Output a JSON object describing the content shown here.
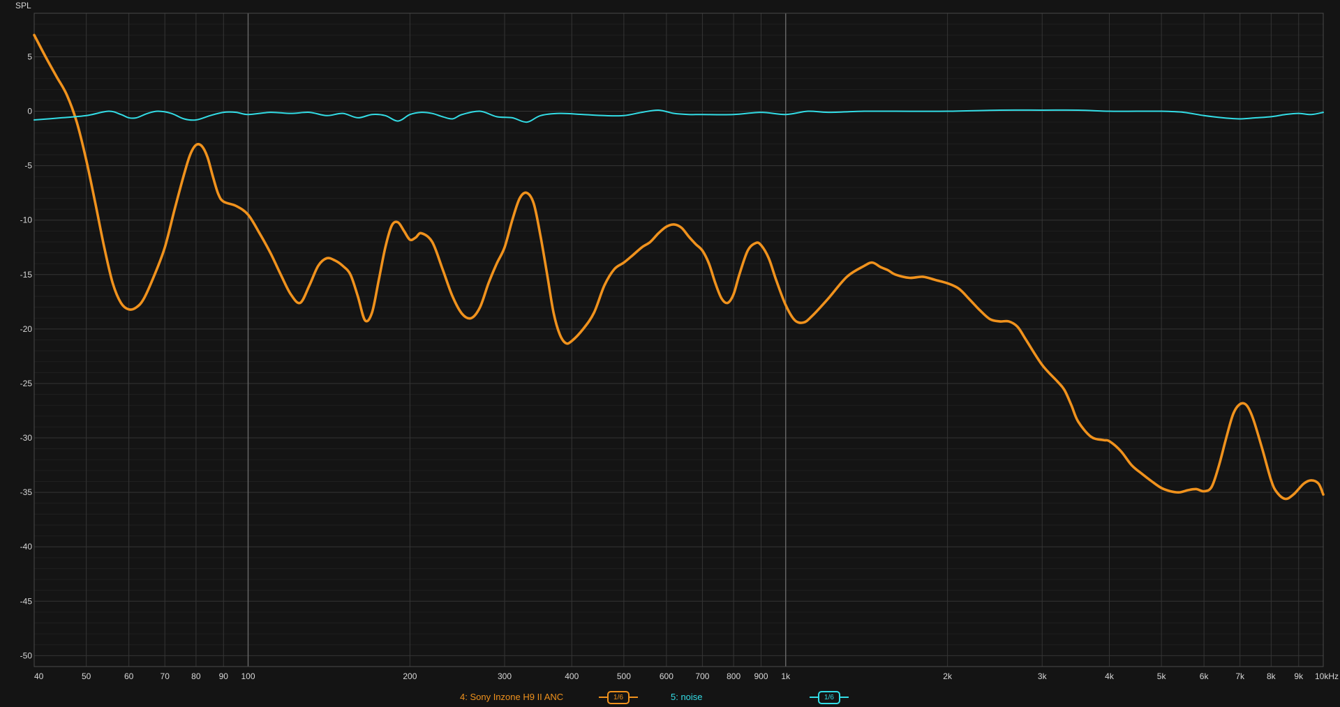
{
  "chart_data": {
    "type": "line",
    "ylabel": "SPL",
    "x_scale": "log",
    "xlim": [
      40,
      10000
    ],
    "ylim": [
      -51,
      9
    ],
    "grid": true,
    "y_ticks": [
      5,
      0,
      -5,
      -10,
      -15,
      -20,
      -25,
      -30,
      -35,
      -40,
      -45,
      -50
    ],
    "y_tick_labels": [
      "5",
      "0",
      "-5",
      "-10",
      "-15",
      "-20",
      "-25",
      "-30",
      "-35",
      "-40",
      "-45",
      "-50"
    ],
    "x_ticks": [
      40,
      50,
      60,
      70,
      80,
      90,
      100,
      200,
      300,
      400,
      500,
      600,
      700,
      800,
      900,
      1000,
      2000,
      3000,
      4000,
      5000,
      6000,
      7000,
      8000,
      9000,
      10000
    ],
    "x_tick_labels": [
      "40",
      "50",
      "60",
      "70",
      "80",
      "90",
      "100",
      "200",
      "300",
      "400",
      "500",
      "600",
      "700",
      "800",
      "900",
      "1k",
      "2k",
      "3k",
      "4k",
      "5k",
      "6k",
      "7k",
      "8k",
      "9k",
      "10kHz"
    ],
    "series": [
      {
        "name": "4: Sony Inzone H9 II ANC",
        "color": "#f0921d",
        "smoothing": "1/6",
        "points": [
          [
            40,
            7.0
          ],
          [
            42,
            5.0
          ],
          [
            44,
            3.2
          ],
          [
            46,
            1.5
          ],
          [
            48,
            -1.0
          ],
          [
            50,
            -4.5
          ],
          [
            52,
            -8.5
          ],
          [
            54,
            -12.5
          ],
          [
            56,
            -15.8
          ],
          [
            58,
            -17.6
          ],
          [
            60,
            -18.2
          ],
          [
            62,
            -18.0
          ],
          [
            64,
            -17.2
          ],
          [
            67,
            -15.0
          ],
          [
            70,
            -12.5
          ],
          [
            73,
            -9.0
          ],
          [
            76,
            -5.8
          ],
          [
            78,
            -4.0
          ],
          [
            80,
            -3.1
          ],
          [
            82,
            -3.2
          ],
          [
            84,
            -4.2
          ],
          [
            86,
            -6.0
          ],
          [
            88,
            -7.6
          ],
          [
            90,
            -8.3
          ],
          [
            95,
            -8.7
          ],
          [
            100,
            -9.5
          ],
          [
            105,
            -11.2
          ],
          [
            110,
            -13.0
          ],
          [
            115,
            -15.0
          ],
          [
            120,
            -16.8
          ],
          [
            125,
            -17.6
          ],
          [
            130,
            -16.0
          ],
          [
            135,
            -14.2
          ],
          [
            140,
            -13.5
          ],
          [
            145,
            -13.7
          ],
          [
            150,
            -14.2
          ],
          [
            155,
            -15.0
          ],
          [
            160,
            -17.0
          ],
          [
            165,
            -19.2
          ],
          [
            170,
            -18.5
          ],
          [
            175,
            -15.5
          ],
          [
            180,
            -12.5
          ],
          [
            185,
            -10.5
          ],
          [
            190,
            -10.2
          ],
          [
            195,
            -11.0
          ],
          [
            200,
            -11.8
          ],
          [
            205,
            -11.6
          ],
          [
            210,
            -11.2
          ],
          [
            220,
            -12.0
          ],
          [
            230,
            -14.5
          ],
          [
            240,
            -17.0
          ],
          [
            250,
            -18.6
          ],
          [
            260,
            -19.0
          ],
          [
            270,
            -18.0
          ],
          [
            280,
            -15.8
          ],
          [
            290,
            -14.0
          ],
          [
            300,
            -12.5
          ],
          [
            310,
            -10.0
          ],
          [
            320,
            -8.0
          ],
          [
            330,
            -7.5
          ],
          [
            340,
            -8.5
          ],
          [
            350,
            -11.5
          ],
          [
            360,
            -15.0
          ],
          [
            370,
            -18.5
          ],
          [
            380,
            -20.5
          ],
          [
            390,
            -21.3
          ],
          [
            400,
            -21.1
          ],
          [
            420,
            -20.0
          ],
          [
            440,
            -18.5
          ],
          [
            460,
            -16.0
          ],
          [
            480,
            -14.5
          ],
          [
            500,
            -13.9
          ],
          [
            520,
            -13.2
          ],
          [
            540,
            -12.5
          ],
          [
            560,
            -12.0
          ],
          [
            580,
            -11.2
          ],
          [
            600,
            -10.6
          ],
          [
            620,
            -10.4
          ],
          [
            640,
            -10.7
          ],
          [
            660,
            -11.5
          ],
          [
            680,
            -12.2
          ],
          [
            700,
            -12.8
          ],
          [
            720,
            -14.0
          ],
          [
            740,
            -15.8
          ],
          [
            760,
            -17.2
          ],
          [
            780,
            -17.6
          ],
          [
            800,
            -16.8
          ],
          [
            820,
            -15.0
          ],
          [
            850,
            -12.8
          ],
          [
            880,
            -12.1
          ],
          [
            900,
            -12.3
          ],
          [
            930,
            -13.5
          ],
          [
            960,
            -15.5
          ],
          [
            1000,
            -17.8
          ],
          [
            1040,
            -19.2
          ],
          [
            1080,
            -19.4
          ],
          [
            1120,
            -18.8
          ],
          [
            1200,
            -17.2
          ],
          [
            1300,
            -15.2
          ],
          [
            1400,
            -14.2
          ],
          [
            1450,
            -13.9
          ],
          [
            1500,
            -14.3
          ],
          [
            1550,
            -14.6
          ],
          [
            1600,
            -15.0
          ],
          [
            1700,
            -15.3
          ],
          [
            1800,
            -15.2
          ],
          [
            1900,
            -15.5
          ],
          [
            2000,
            -15.8
          ],
          [
            2100,
            -16.3
          ],
          [
            2200,
            -17.3
          ],
          [
            2300,
            -18.3
          ],
          [
            2400,
            -19.1
          ],
          [
            2500,
            -19.3
          ],
          [
            2600,
            -19.3
          ],
          [
            2700,
            -19.8
          ],
          [
            2800,
            -21.0
          ],
          [
            3000,
            -23.3
          ],
          [
            3200,
            -24.8
          ],
          [
            3300,
            -25.6
          ],
          [
            3400,
            -27.0
          ],
          [
            3500,
            -28.5
          ],
          [
            3700,
            -29.9
          ],
          [
            3900,
            -30.2
          ],
          [
            4000,
            -30.3
          ],
          [
            4200,
            -31.2
          ],
          [
            4400,
            -32.5
          ],
          [
            4600,
            -33.3
          ],
          [
            4800,
            -34.0
          ],
          [
            5000,
            -34.6
          ],
          [
            5200,
            -34.9
          ],
          [
            5400,
            -35.0
          ],
          [
            5600,
            -34.8
          ],
          [
            5800,
            -34.7
          ],
          [
            6000,
            -34.9
          ],
          [
            6200,
            -34.5
          ],
          [
            6400,
            -32.5
          ],
          [
            6600,
            -30.0
          ],
          [
            6800,
            -27.8
          ],
          [
            7000,
            -26.9
          ],
          [
            7200,
            -27.0
          ],
          [
            7400,
            -28.2
          ],
          [
            7700,
            -31.0
          ],
          [
            8000,
            -33.9
          ],
          [
            8200,
            -35.0
          ],
          [
            8500,
            -35.6
          ],
          [
            8800,
            -35.2
          ],
          [
            9200,
            -34.2
          ],
          [
            9500,
            -33.9
          ],
          [
            9800,
            -34.2
          ],
          [
            10000,
            -35.2
          ]
        ]
      },
      {
        "name": "5: noise",
        "color": "#33dde6",
        "smoothing": "1/6",
        "points": [
          [
            40,
            -0.8
          ],
          [
            45,
            -0.6
          ],
          [
            50,
            -0.4
          ],
          [
            55,
            0.0
          ],
          [
            58,
            -0.3
          ],
          [
            60,
            -0.6
          ],
          [
            62,
            -0.6
          ],
          [
            65,
            -0.2
          ],
          [
            68,
            0.0
          ],
          [
            72,
            -0.2
          ],
          [
            76,
            -0.7
          ],
          [
            80,
            -0.8
          ],
          [
            85,
            -0.4
          ],
          [
            90,
            -0.1
          ],
          [
            95,
            -0.1
          ],
          [
            100,
            -0.3
          ],
          [
            110,
            -0.1
          ],
          [
            120,
            -0.2
          ],
          [
            130,
            -0.1
          ],
          [
            140,
            -0.4
          ],
          [
            150,
            -0.2
          ],
          [
            160,
            -0.6
          ],
          [
            170,
            -0.3
          ],
          [
            180,
            -0.4
          ],
          [
            190,
            -0.9
          ],
          [
            200,
            -0.3
          ],
          [
            210,
            -0.1
          ],
          [
            220,
            -0.2
          ],
          [
            230,
            -0.5
          ],
          [
            240,
            -0.7
          ],
          [
            250,
            -0.3
          ],
          [
            270,
            0.0
          ],
          [
            290,
            -0.5
          ],
          [
            310,
            -0.6
          ],
          [
            330,
            -1.0
          ],
          [
            350,
            -0.4
          ],
          [
            380,
            -0.2
          ],
          [
            420,
            -0.3
          ],
          [
            460,
            -0.4
          ],
          [
            500,
            -0.4
          ],
          [
            540,
            -0.1
          ],
          [
            580,
            0.1
          ],
          [
            620,
            -0.2
          ],
          [
            660,
            -0.3
          ],
          [
            700,
            -0.3
          ],
          [
            800,
            -0.3
          ],
          [
            900,
            -0.1
          ],
          [
            1000,
            -0.3
          ],
          [
            1100,
            0.0
          ],
          [
            1200,
            -0.1
          ],
          [
            1400,
            0.0
          ],
          [
            1600,
            0.0
          ],
          [
            2000,
            0.0
          ],
          [
            2500,
            0.1
          ],
          [
            3000,
            0.1
          ],
          [
            3500,
            0.1
          ],
          [
            4000,
            0.0
          ],
          [
            4500,
            0.0
          ],
          [
            5000,
            0.0
          ],
          [
            5500,
            -0.1
          ],
          [
            6000,
            -0.4
          ],
          [
            6500,
            -0.6
          ],
          [
            7000,
            -0.7
          ],
          [
            7500,
            -0.6
          ],
          [
            8000,
            -0.5
          ],
          [
            8500,
            -0.3
          ],
          [
            9000,
            -0.2
          ],
          [
            9500,
            -0.3
          ],
          [
            10000,
            -0.1
          ]
        ]
      }
    ]
  },
  "legend": {
    "series1_label": "4: Sony Inzone H9 II ANC",
    "series1_color": "#f0921d",
    "series1_smoothing": "1/6",
    "series2_label": "5: noise",
    "series2_color": "#33dde6",
    "series2_smoothing": "1/6"
  }
}
